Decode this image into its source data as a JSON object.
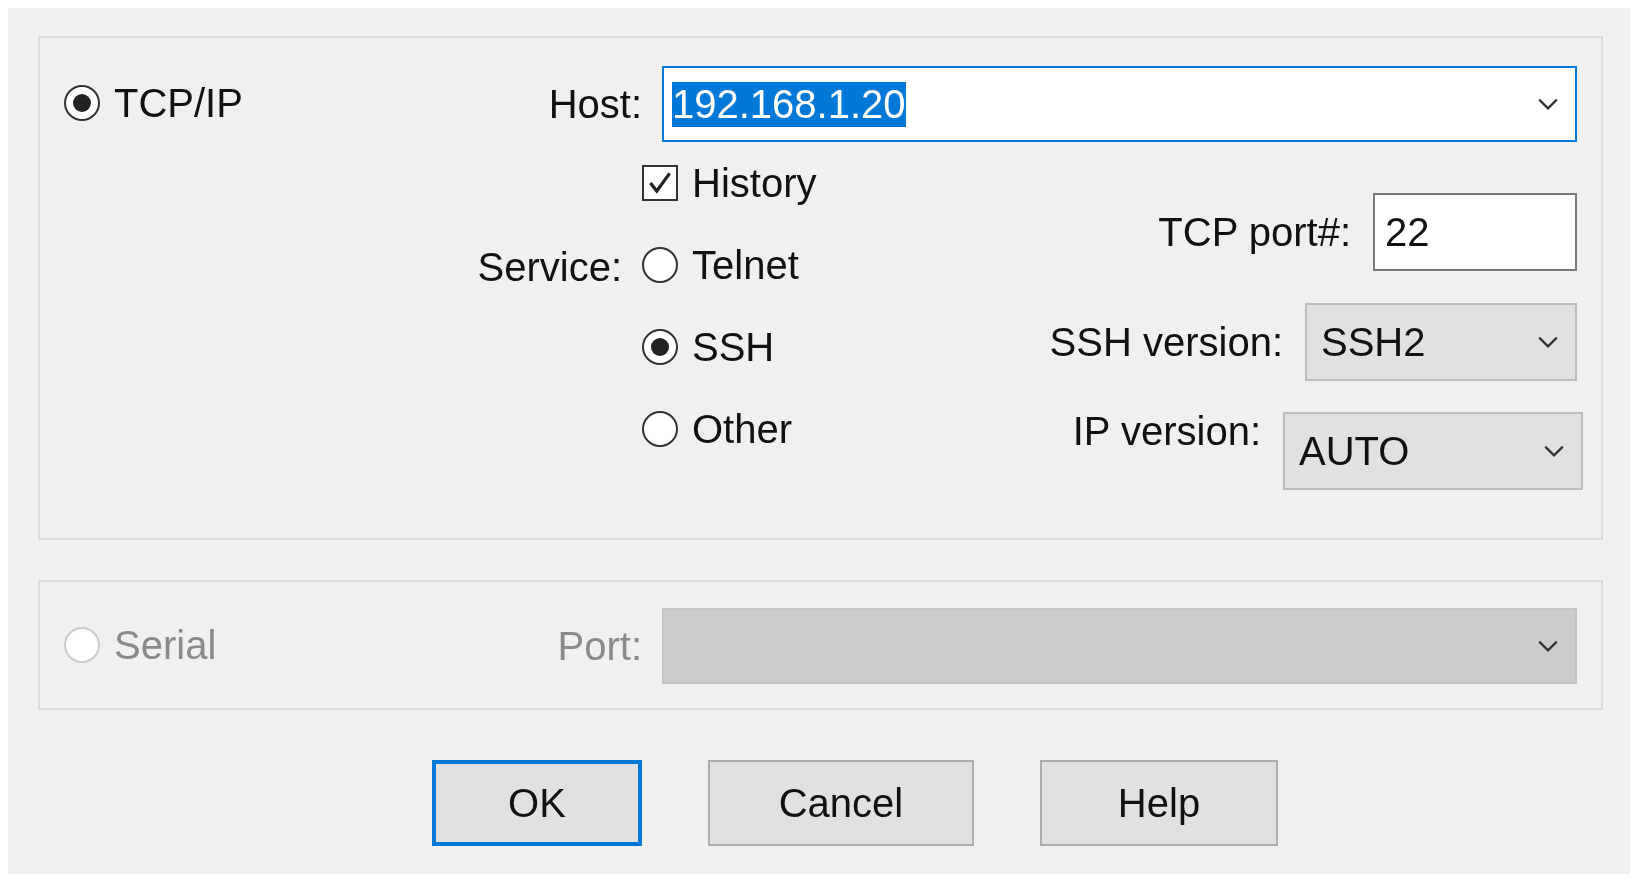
{
  "tcpip": {
    "radio": {
      "label": "TCP/IP",
      "selected": true
    },
    "host": {
      "label": "Host:",
      "value": "192.168.1.20",
      "focused": true,
      "text_selected": true
    },
    "history": {
      "label": "History",
      "checked": true
    },
    "service": {
      "label": "Service:",
      "options": [
        {
          "label": "Telnet",
          "selected": false
        },
        {
          "label": "SSH",
          "selected": true
        },
        {
          "label": "Other",
          "selected": false
        }
      ]
    },
    "tcp_port": {
      "label": "TCP port#:",
      "value": "22"
    },
    "ssh_version": {
      "label": "SSH version:",
      "value": "SSH2"
    },
    "ip_version": {
      "label": "IP version:",
      "value": "AUTO"
    }
  },
  "serial": {
    "radio": {
      "label": "Serial",
      "selected": false
    },
    "disabled": true,
    "port": {
      "label": "Port:"
    }
  },
  "buttons": [
    {
      "label": "OK",
      "default": true
    },
    {
      "label": "Cancel",
      "default": false
    },
    {
      "label": "Help",
      "default": false
    }
  ]
}
